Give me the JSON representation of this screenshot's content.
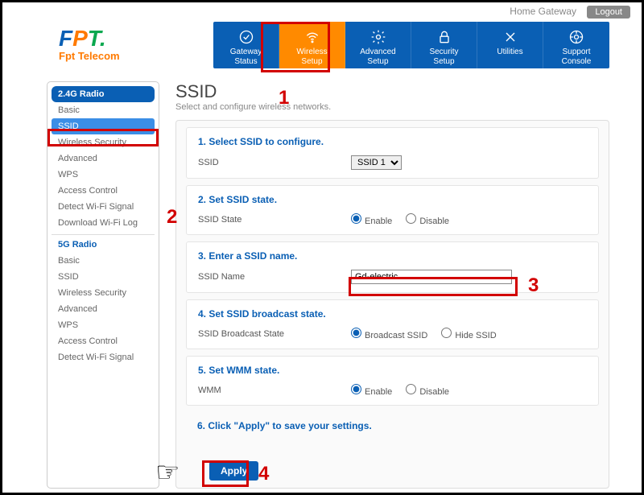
{
  "topbar": {
    "home": "Home Gateway",
    "logout": "Logout"
  },
  "logo": {
    "brand_sub": "Fpt Telecom"
  },
  "nav": [
    {
      "label": "Gateway\nStatus",
      "icon": "check-circle"
    },
    {
      "label": "Wireless\nSetup",
      "icon": "wifi",
      "active": true
    },
    {
      "label": "Advanced\nSetup",
      "icon": "gear"
    },
    {
      "label": "Security\nSetup",
      "icon": "lock"
    },
    {
      "label": "Utilities",
      "icon": "tools"
    },
    {
      "label": "Support\nConsole",
      "icon": "support"
    }
  ],
  "sidebar": {
    "section24": "2.4G Radio",
    "items24": [
      "Basic",
      "SSID",
      "Wireless Security",
      "Advanced",
      "WPS",
      "Access Control",
      "Detect Wi-Fi Signal",
      "Download Wi-Fi Log"
    ],
    "section5g": "5G Radio",
    "items5g": [
      "Basic",
      "SSID",
      "Wireless Security",
      "Advanced",
      "WPS",
      "Access Control",
      "Detect Wi-Fi Signal"
    ]
  },
  "page": {
    "title": "SSID",
    "subtitle": "Select and configure wireless networks."
  },
  "sections": {
    "s1": {
      "title": "1. Select SSID to configure.",
      "label": "SSID",
      "select": "SSID 1"
    },
    "s2": {
      "title": "2. Set SSID state.",
      "label": "SSID State",
      "opt1": "Enable",
      "opt2": "Disable"
    },
    "s3": {
      "title": "3. Enter a SSID name.",
      "label": "SSID Name",
      "value": "Gd-electric"
    },
    "s4": {
      "title": "4. Set SSID broadcast state.",
      "label": "SSID Broadcast State",
      "opt1": "Broadcast SSID",
      "opt2": "Hide SSID"
    },
    "s5": {
      "title": "5. Set WMM state.",
      "label": "WMM",
      "opt1": "Enable",
      "opt2": "Disable"
    },
    "s6": {
      "title": "6. Click \"Apply\" to save your settings."
    }
  },
  "apply": "Apply",
  "annot": {
    "n1": "1",
    "n2": "2",
    "n3": "3",
    "n4": "4"
  }
}
